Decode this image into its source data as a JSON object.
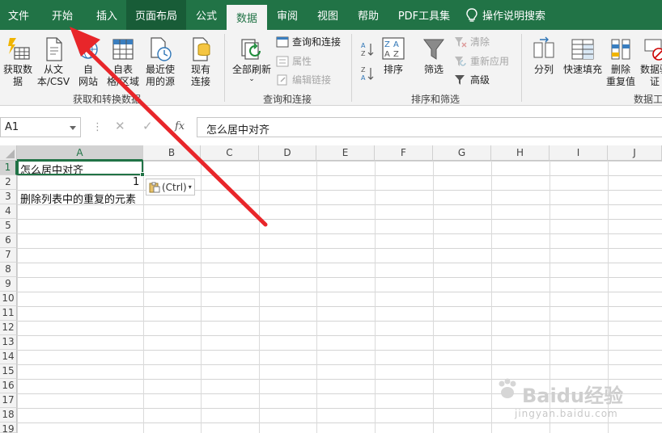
{
  "menu": {
    "tabs": [
      {
        "label": "文件"
      },
      {
        "label": "开始"
      },
      {
        "label": "插入"
      },
      {
        "label": "页面布局"
      },
      {
        "label": "公式"
      },
      {
        "label": "数据"
      },
      {
        "label": "审阅"
      },
      {
        "label": "视图"
      },
      {
        "label": "帮助"
      },
      {
        "label": "PDF工具集"
      }
    ],
    "tell_me": "操作说明搜索",
    "active_tab": "数据"
  },
  "ribbon": {
    "get_transform": {
      "get_data": "获取数\n据",
      "from_text": "从文\n本/CSV",
      "from_web": "自\n网站",
      "from_table": "自表\n格/区域",
      "recent_sources": "最近使\n用的源",
      "existing": "现有\n连接",
      "label": "获取和转换数据"
    },
    "queries": {
      "refresh_all": "全部刷新",
      "queries_connections": "查询和连接",
      "properties": "属性",
      "edit_links": "编辑链接",
      "label": "查询和连接"
    },
    "sort_filter": {
      "sort": "排序",
      "filter": "筛选",
      "clear": "清除",
      "reapply": "重新应用",
      "advanced": "高级",
      "label": "排序和筛选"
    },
    "data_tools": {
      "split": "分列",
      "flash_fill": "快速填充",
      "remove_dup": "删除\n重复值",
      "validation": "数据验\n证",
      "label": "数据工"
    }
  },
  "formula_bar": {
    "name_box": "A1",
    "fx": "fx",
    "content": "怎么居中对齐"
  },
  "grid": {
    "columns": [
      "A",
      "B",
      "C",
      "D",
      "E",
      "F",
      "G",
      "H",
      "I",
      "J"
    ],
    "rows": [
      "1",
      "2",
      "3",
      "4",
      "5",
      "6",
      "7",
      "8",
      "9",
      "10",
      "11",
      "12",
      "13",
      "14",
      "15",
      "16",
      "17",
      "18",
      "19"
    ],
    "cells": {
      "A1": "怎么居中对齐",
      "A2": "1",
      "A3": "删除列表中的重复的元素"
    },
    "paste_options": "(Ctrl)"
  },
  "watermark": {
    "text": "Baidu经验",
    "url": "jingyan.baidu.com"
  },
  "colors": {
    "excel_green": "#217346",
    "dark_green": "#185c37",
    "arrow_red": "#e8262a"
  }
}
